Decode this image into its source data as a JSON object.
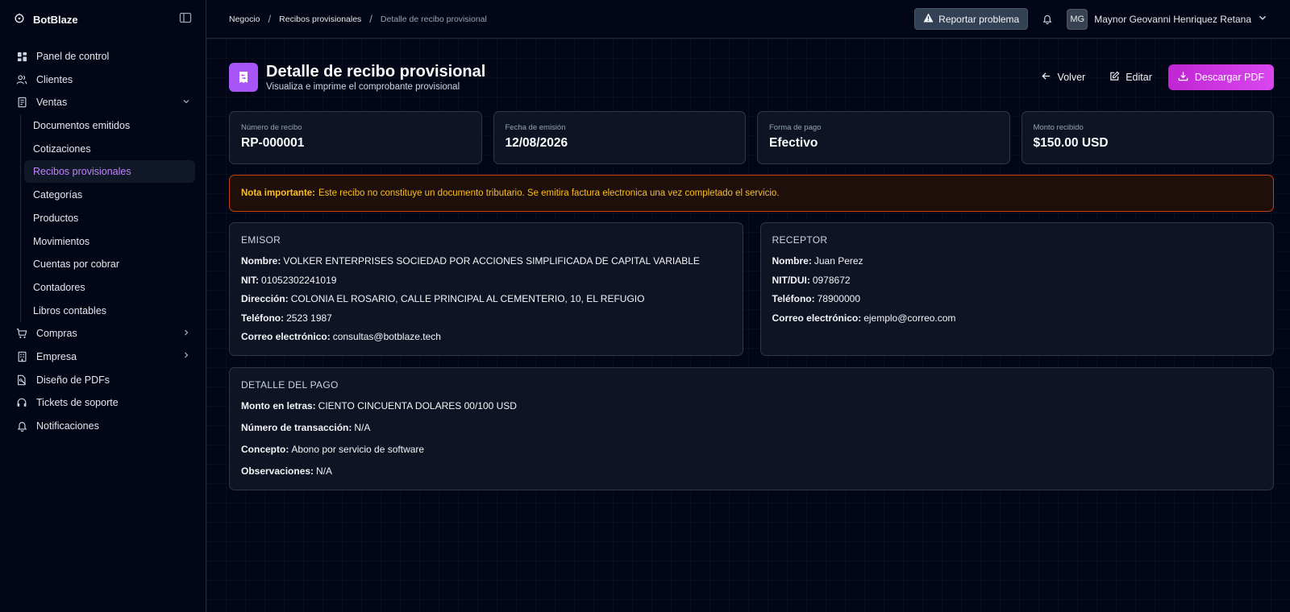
{
  "brand": {
    "name": "BotBlaze"
  },
  "sidebar": {
    "items": [
      {
        "label": "Panel de control",
        "icon": "dashboard-icon"
      },
      {
        "label": "Clientes",
        "icon": "users-icon"
      },
      {
        "label": "Ventas",
        "icon": "receipt-icon",
        "expanded": true
      },
      {
        "label": "Compras",
        "icon": "cart-icon"
      },
      {
        "label": "Empresa",
        "icon": "building-icon"
      },
      {
        "label": "Diseño de PDFs",
        "icon": "pdf-design-icon"
      },
      {
        "label": "Tickets de soporte",
        "icon": "headset-icon"
      },
      {
        "label": "Notificaciones",
        "icon": "bell-icon"
      }
    ],
    "ventas_sub": [
      "Documentos emitidos",
      "Cotizaciones",
      "Recibos provisionales",
      "Categorías",
      "Productos",
      "Movimientos",
      "Cuentas por cobrar",
      "Contadores",
      "Libros contables"
    ],
    "active_sub": "Recibos provisionales"
  },
  "topbar": {
    "breadcrumb": [
      "Negocio",
      "Recibos provisionales",
      "Detalle de recibo provisional"
    ],
    "report_label": "Reportar problema",
    "user_initials": "MG",
    "user_name": "Maynor Geovanni Henriquez Retana"
  },
  "page": {
    "title": "Detalle de recibo provisional",
    "subtitle": "Visualiza e imprime el comprobante provisional",
    "back_label": "Volver",
    "edit_label": "Editar",
    "download_label": "Descargar PDF"
  },
  "stats": [
    {
      "label": "Número de recibo",
      "value": "RP-000001"
    },
    {
      "label": "Fecha de emisión",
      "value": "12/08/2026"
    },
    {
      "label": "Forma de pago",
      "value": "Efectivo"
    },
    {
      "label": "Monto recibido",
      "value": "$150.00 USD"
    }
  ],
  "note": {
    "label": "Nota importante:",
    "text": "Este recibo no constituye un documento tributario. Se emitira factura electronica una vez completado el servicio."
  },
  "emisor": {
    "title": "EMISOR",
    "rows": [
      {
        "label": "Nombre:",
        "value": "VOLKER ENTERPRISES SOCIEDAD POR ACCIONES SIMPLIFICADA DE CAPITAL VARIABLE"
      },
      {
        "label": "NIT:",
        "value": "01052302241019"
      },
      {
        "label": "Dirección:",
        "value": "COLONIA EL ROSARIO, CALLE PRINCIPAL AL CEMENTERIO, 10, EL REFUGIO"
      },
      {
        "label": "Teléfono:",
        "value": "2523 1987"
      },
      {
        "label": "Correo electrónico:",
        "value": "consultas@botblaze.tech"
      }
    ]
  },
  "receptor": {
    "title": "RECEPTOR",
    "rows": [
      {
        "label": "Nombre:",
        "value": "Juan Perez"
      },
      {
        "label": "NIT/DUI:",
        "value": "0978672"
      },
      {
        "label": "Teléfono:",
        "value": "78900000"
      },
      {
        "label": "Correo electrónico:",
        "value": "ejemplo@correo.com"
      }
    ]
  },
  "payment": {
    "title": "DETALLE DEL PAGO",
    "rows": [
      {
        "label": "Monto en letras:",
        "value": "CIENTO CINCUENTA DOLARES 00/100 USD"
      },
      {
        "label": "Número de transacción:",
        "value": "N/A"
      },
      {
        "label": "Concepto:",
        "value": "Abono por servicio de software"
      },
      {
        "label": "Observaciones:",
        "value": "N/A"
      }
    ]
  },
  "colors": {
    "accent": "#a855f7",
    "primary_button": "#c026d3",
    "warning_border": "#c2410c",
    "warning_text": "#fbbf24",
    "background": "#030617"
  }
}
